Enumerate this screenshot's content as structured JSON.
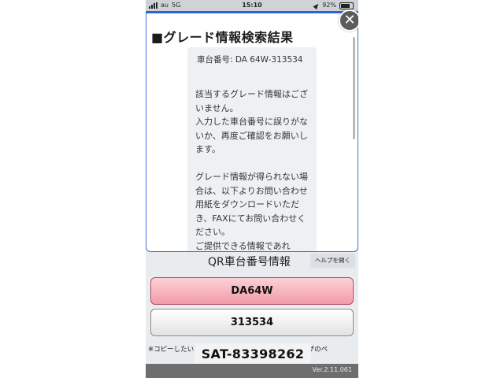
{
  "status_bar": {
    "carrier": "au",
    "network": "5G",
    "time": "15:10",
    "battery": "92%"
  },
  "modal": {
    "title": "■グレード情報検索結果",
    "close_icon": "close-icon",
    "car_number": "車台番号: DA 64W-313534",
    "message": "該当するグレード情報はございません。\n入力した車台番号に誤りがないか、再度ご確認をお願いします。\n\nグレード情報が得られない場合は、以下よりお問い合わせ用紙をダウンロードいただき、FAXにてお問い合わせください。\nご提供できる情報であれ"
  },
  "qr_section": {
    "label": "QR車台番号情報",
    "help_button": "ヘルプを開く"
  },
  "fields": {
    "model": "DA64W",
    "serial": "313534"
  },
  "note": "※コピーしたい車台番号をタップし、コピーはブラウザのペ",
  "overlay_label": "SAT-83398262",
  "version": "Ver.2.11.061",
  "colors": {
    "accent_blue": "#2b63d8",
    "pink_field": "#f29ba8",
    "close_button": "#5c5c5c"
  }
}
